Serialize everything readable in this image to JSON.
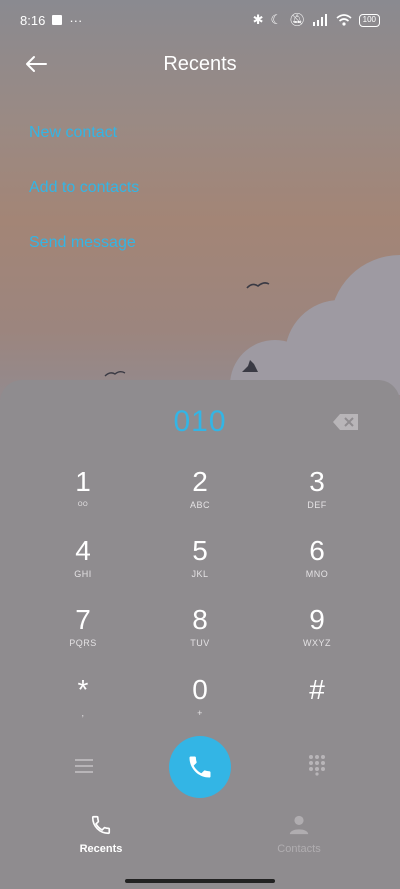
{
  "status": {
    "time": "8:16",
    "overflow": "···",
    "battery": "100"
  },
  "header": {
    "title": "Recents",
    "back_icon": "arrow-left-icon"
  },
  "actions": [
    {
      "label": "New contact"
    },
    {
      "label": "Add to contacts"
    },
    {
      "label": "Send message"
    }
  ],
  "dialer": {
    "number": "010",
    "keys": [
      {
        "digit": "1",
        "letters": "ᴼᴼ"
      },
      {
        "digit": "2",
        "letters": "ABC"
      },
      {
        "digit": "3",
        "letters": "DEF"
      },
      {
        "digit": "4",
        "letters": "GHI"
      },
      {
        "digit": "5",
        "letters": "JKL"
      },
      {
        "digit": "6",
        "letters": "MNO"
      },
      {
        "digit": "7",
        "letters": "PQRS"
      },
      {
        "digit": "8",
        "letters": "TUV"
      },
      {
        "digit": "9",
        "letters": "WXYZ"
      },
      {
        "digit": "*",
        "letters": ","
      },
      {
        "digit": "0",
        "letters": "+"
      },
      {
        "digit": "#",
        "letters": ""
      }
    ]
  },
  "tabs": [
    {
      "label": "Recents",
      "active": true
    },
    {
      "label": "Contacts",
      "active": false
    }
  ],
  "colors": {
    "accent": "#33b5e5"
  }
}
